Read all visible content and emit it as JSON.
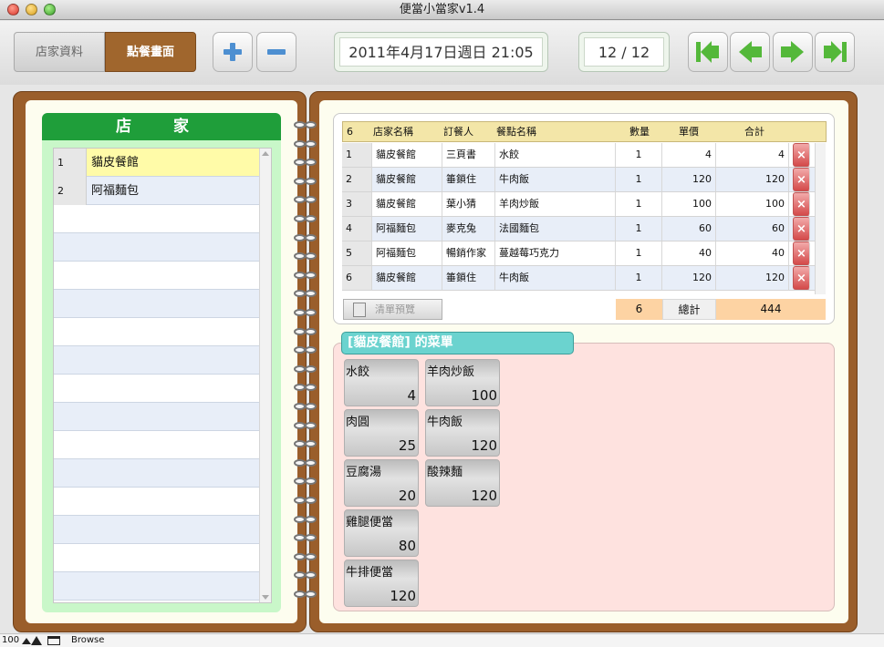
{
  "window": {
    "title": "便當小當家v1.4"
  },
  "toolbar": {
    "tab_shops": "店家資料",
    "tab_order": "點餐畫面",
    "datetime": "2011年4月17日週日 21:05",
    "record": "12 / 12"
  },
  "colors": {
    "accent_brown": "#a0662d",
    "shop_header": "#1f9e3a",
    "menu_tab": "#6bd3cf",
    "nav_arrow": "#54b83a"
  },
  "shops": {
    "header": "店 家",
    "rows": [
      {
        "no": "1",
        "name": "貓皮餐館"
      },
      {
        "no": "2",
        "name": "阿福麵包"
      }
    ]
  },
  "orders": {
    "headers": {
      "count": "6",
      "shop": "店家名稱",
      "orderer": "訂餐人",
      "dish": "餐點名稱",
      "qty": "數量",
      "price": "單價",
      "subtotal": "合計"
    },
    "rows": [
      {
        "no": "1",
        "shop": "貓皮餐館",
        "orderer": "三頁書",
        "dish": "水餃",
        "qty": "1",
        "price": "4",
        "subtotal": "4"
      },
      {
        "no": "2",
        "shop": "貓皮餐館",
        "orderer": "箠鎖住",
        "dish": "牛肉飯",
        "qty": "1",
        "price": "120",
        "subtotal": "120"
      },
      {
        "no": "3",
        "shop": "貓皮餐館",
        "orderer": "葉小猜",
        "dish": "羊肉炒飯",
        "qty": "1",
        "price": "100",
        "subtotal": "100"
      },
      {
        "no": "4",
        "shop": "阿福麵包",
        "orderer": "麥克兔",
        "dish": "法國麵包",
        "qty": "1",
        "price": "60",
        "subtotal": "60"
      },
      {
        "no": "5",
        "shop": "阿福麵包",
        "orderer": "暢銷作家",
        "dish": "蔓越莓巧克力",
        "qty": "1",
        "price": "40",
        "subtotal": "40"
      },
      {
        "no": "6",
        "shop": "貓皮餐館",
        "orderer": "箠鎖住",
        "dish": "牛肉飯",
        "qty": "1",
        "price": "120",
        "subtotal": "120"
      }
    ],
    "preview_button": "清單預覽",
    "total_count": "6",
    "total_label": "總計",
    "total_amount": "444"
  },
  "menu": {
    "title": "[貓皮餐館] 的菜單",
    "items": [
      {
        "name": "水餃",
        "price": "4"
      },
      {
        "name": "羊肉炒飯",
        "price": "100"
      },
      {
        "name": "肉圓",
        "price": "25"
      },
      {
        "name": "牛肉飯",
        "price": "120"
      },
      {
        "name": "豆腐湯",
        "price": "20"
      },
      {
        "name": "酸辣麵",
        "price": "120"
      },
      {
        "name": "雞腿便當",
        "price": "80"
      },
      {
        "name": "牛排便當",
        "price": "120"
      }
    ]
  },
  "status": {
    "zoom": "100",
    "mode": "Browse"
  }
}
